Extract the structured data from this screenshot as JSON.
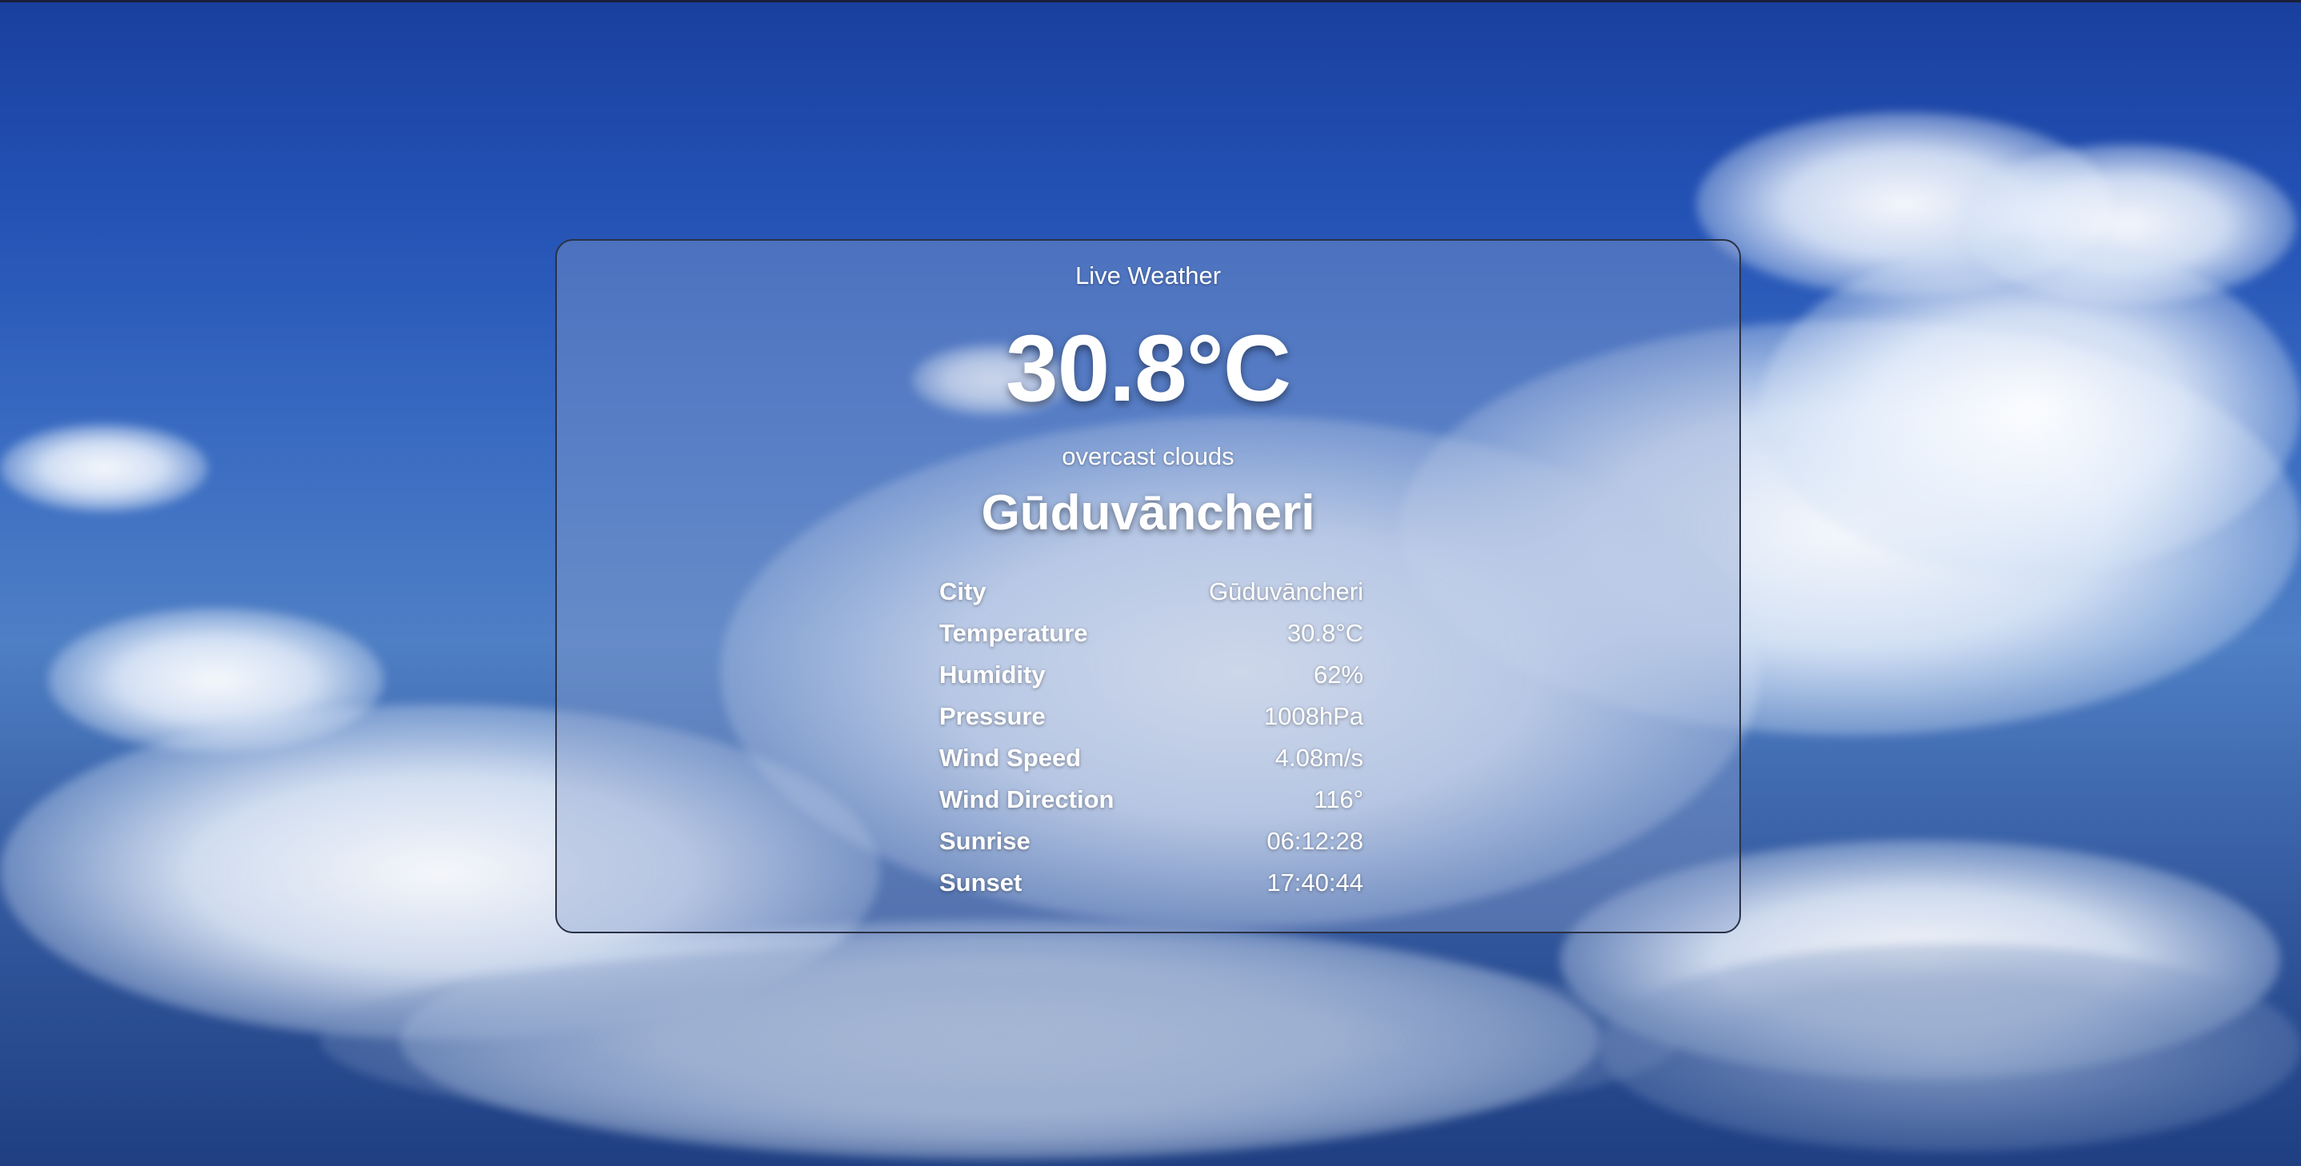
{
  "card": {
    "title": "Live Weather",
    "temperature": "30.8°C",
    "condition": "overcast clouds",
    "city": "Gūduvāncheri"
  },
  "details": [
    {
      "label": "City",
      "value": "Gūduvāncheri"
    },
    {
      "label": "Temperature",
      "value": "30.8°C"
    },
    {
      "label": "Humidity",
      "value": "62%"
    },
    {
      "label": "Pressure",
      "value": "1008hPa"
    },
    {
      "label": "Wind Speed",
      "value": "4.08m/s"
    },
    {
      "label": "Wind Direction",
      "value": "116°"
    },
    {
      "label": "Sunrise",
      "value": "06:12:28"
    },
    {
      "label": "Sunset",
      "value": "17:40:44"
    }
  ],
  "colors": {
    "sky_top": "#1a3f9e",
    "sky_mid": "#4f7fc5",
    "card_border": "#2a3145",
    "text": "#ffffff"
  }
}
